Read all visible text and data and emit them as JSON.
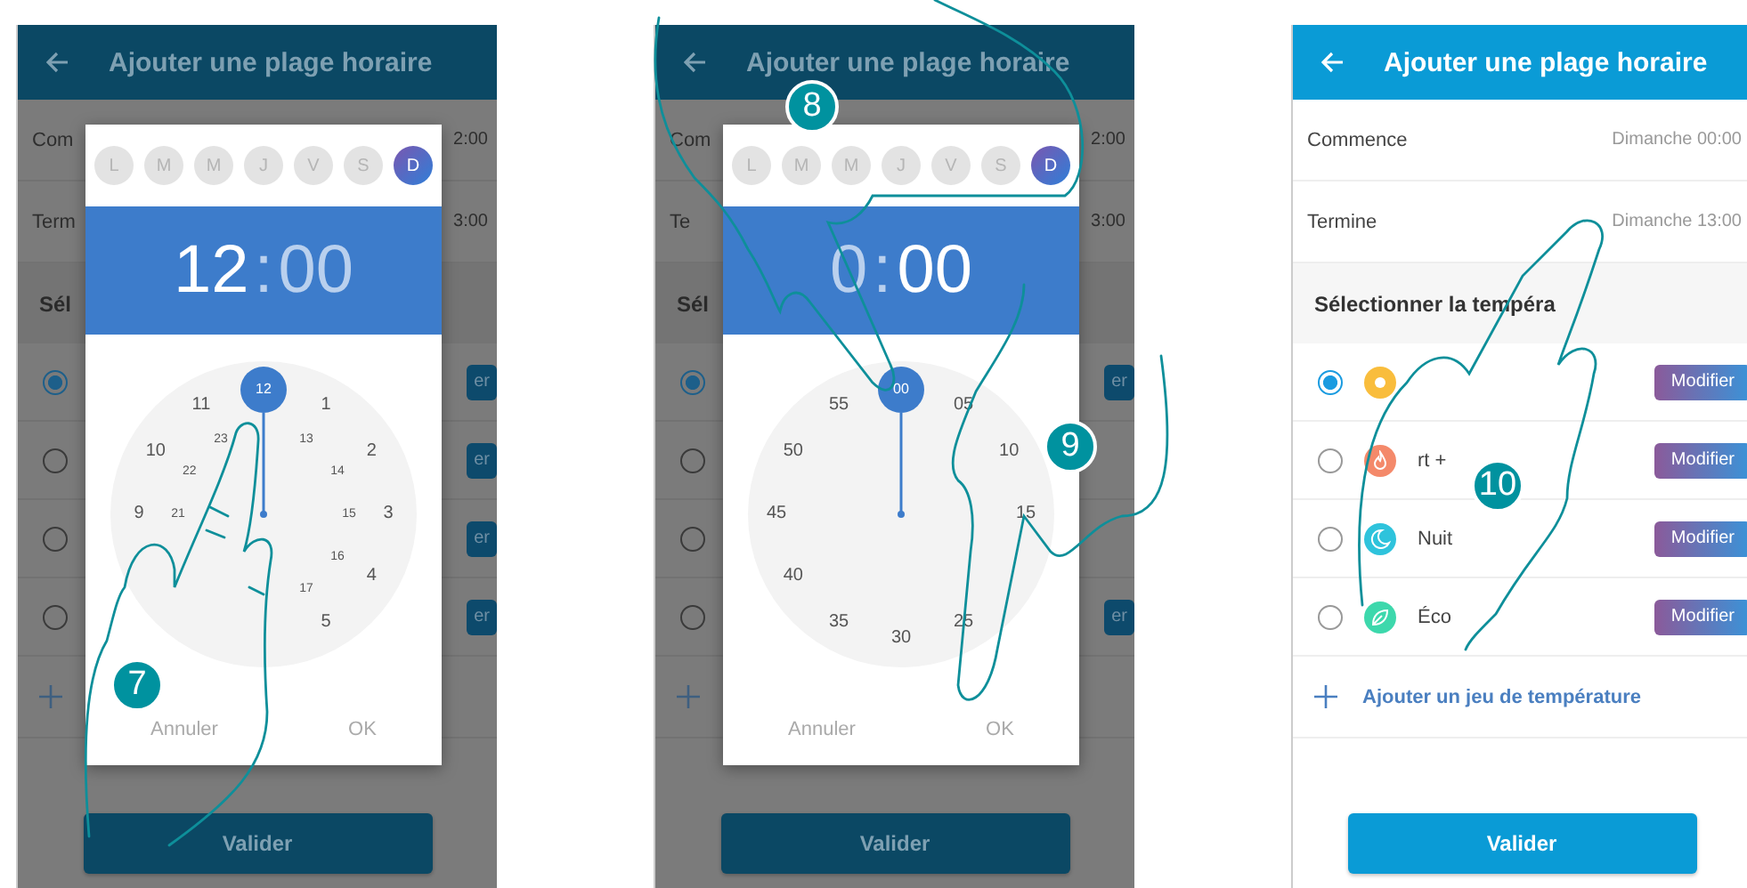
{
  "panels": [
    {
      "dimmed": true,
      "header": {
        "title": "Ajouter une plage horaire"
      },
      "fields": [
        {
          "label": "Com",
          "value": "2:00"
        },
        {
          "label": "Term",
          "value": "3:00"
        }
      ],
      "section": "Sél",
      "rows": [
        {
          "selected": true,
          "modify": "er"
        },
        {
          "selected": false,
          "modify": "er"
        },
        {
          "selected": false,
          "modify": "er"
        },
        {
          "selected": false,
          "modify": "er"
        }
      ],
      "submit": "Valider",
      "dialog": {
        "hours": {
          "text": "12",
          "selected": true
        },
        "separator": ":",
        "minutes": {
          "text": "00",
          "selected": false
        },
        "days": [
          {
            "label": "L",
            "selected": false
          },
          {
            "label": "M",
            "selected": false
          },
          {
            "label": "M",
            "selected": false
          },
          {
            "label": "J",
            "selected": false
          },
          {
            "label": "V",
            "selected": false
          },
          {
            "label": "S",
            "selected": false
          },
          {
            "label": "D",
            "selected": true
          }
        ],
        "dial": [
          {
            "label": "12",
            "selected": true
          },
          {
            "label": "1",
            "selected": false
          },
          {
            "label": "2",
            "selected": false
          },
          {
            "label": "3",
            "selected": false
          },
          {
            "label": "4",
            "selected": false
          },
          {
            "label": "5",
            "selected": false
          },
          {
            "label": "9",
            "selected": false
          },
          {
            "label": "10",
            "selected": false
          },
          {
            "label": "11",
            "selected": false
          },
          {
            "label": "13",
            "selected": false
          },
          {
            "label": "14",
            "selected": false
          },
          {
            "label": "15",
            "selected": false
          },
          {
            "label": "16",
            "selected": false
          },
          {
            "label": "17",
            "selected": false
          },
          {
            "label": "21",
            "selected": false
          },
          {
            "label": "22",
            "selected": false
          },
          {
            "label": "23",
            "selected": false
          }
        ],
        "buttons": [
          "Annuler",
          "OK"
        ]
      },
      "steps": [
        "7"
      ]
    },
    {
      "dimmed": true,
      "header": {
        "title": "Ajouter une plage horaire"
      },
      "fields": [
        {
          "label": "Com",
          "value": "2:00"
        },
        {
          "label": "Te",
          "value": "3:00"
        }
      ],
      "section": "Sél",
      "rows": [
        {
          "selected": true,
          "modify": "er"
        },
        {
          "selected": false
        },
        {
          "selected": false
        },
        {
          "selected": false,
          "modify": "er"
        }
      ],
      "submit": "Valider",
      "dialog": {
        "hours": {
          "text": "0",
          "selected": false
        },
        "separator": ":",
        "minutes": {
          "text": "00",
          "selected": true
        },
        "days": [
          {
            "label": "L",
            "selected": false
          },
          {
            "label": "M",
            "selected": false
          },
          {
            "label": "M",
            "selected": false
          },
          {
            "label": "J",
            "selected": false
          },
          {
            "label": "V",
            "selected": false
          },
          {
            "label": "S",
            "selected": false
          },
          {
            "label": "D",
            "selected": true
          }
        ],
        "dial": [
          {
            "label": "00",
            "selected": true
          },
          {
            "label": "05",
            "selected": false
          },
          {
            "label": "10",
            "selected": false
          },
          {
            "label": "15",
            "selected": false
          },
          {
            "label": "25",
            "selected": false
          },
          {
            "label": "30",
            "selected": false
          },
          {
            "label": "35",
            "selected": false
          },
          {
            "label": "40",
            "selected": false
          },
          {
            "label": "45",
            "selected": false
          },
          {
            "label": "50",
            "selected": false
          },
          {
            "label": "55",
            "selected": false
          }
        ],
        "buttons": [
          "Annuler",
          "OK"
        ]
      },
      "steps": [
        "8",
        "9"
      ]
    },
    {
      "dimmed": false,
      "header": {
        "title": "Ajouter une plage horaire"
      },
      "fields": [
        {
          "label": "Commence",
          "value": "Dimanche 00:00"
        },
        {
          "label": "Termine",
          "value": "Dimanche 13:00"
        }
      ],
      "section": "Sélectionner la tempéra",
      "rows": [
        {
          "selected": true,
          "icon": {
            "kind": "sun",
            "color": "#f9bd3c"
          },
          "modify": "Modifier"
        },
        {
          "selected": false,
          "icon": {
            "kind": "flame",
            "color": "#f4896a"
          },
          "label": "rt +",
          "modify": "Modifier"
        },
        {
          "selected": false,
          "icon": {
            "kind": "moon",
            "color": "#2ec3dc"
          },
          "label": "Nuit",
          "modify": "Modifier"
        },
        {
          "selected": false,
          "icon": {
            "kind": "leaf",
            "color": "#3dd8ac"
          },
          "label": "Éco",
          "modify": "Modifier"
        }
      ],
      "add": "Ajouter un jeu de température",
      "submit": "Valider",
      "steps": [
        "10"
      ]
    }
  ]
}
